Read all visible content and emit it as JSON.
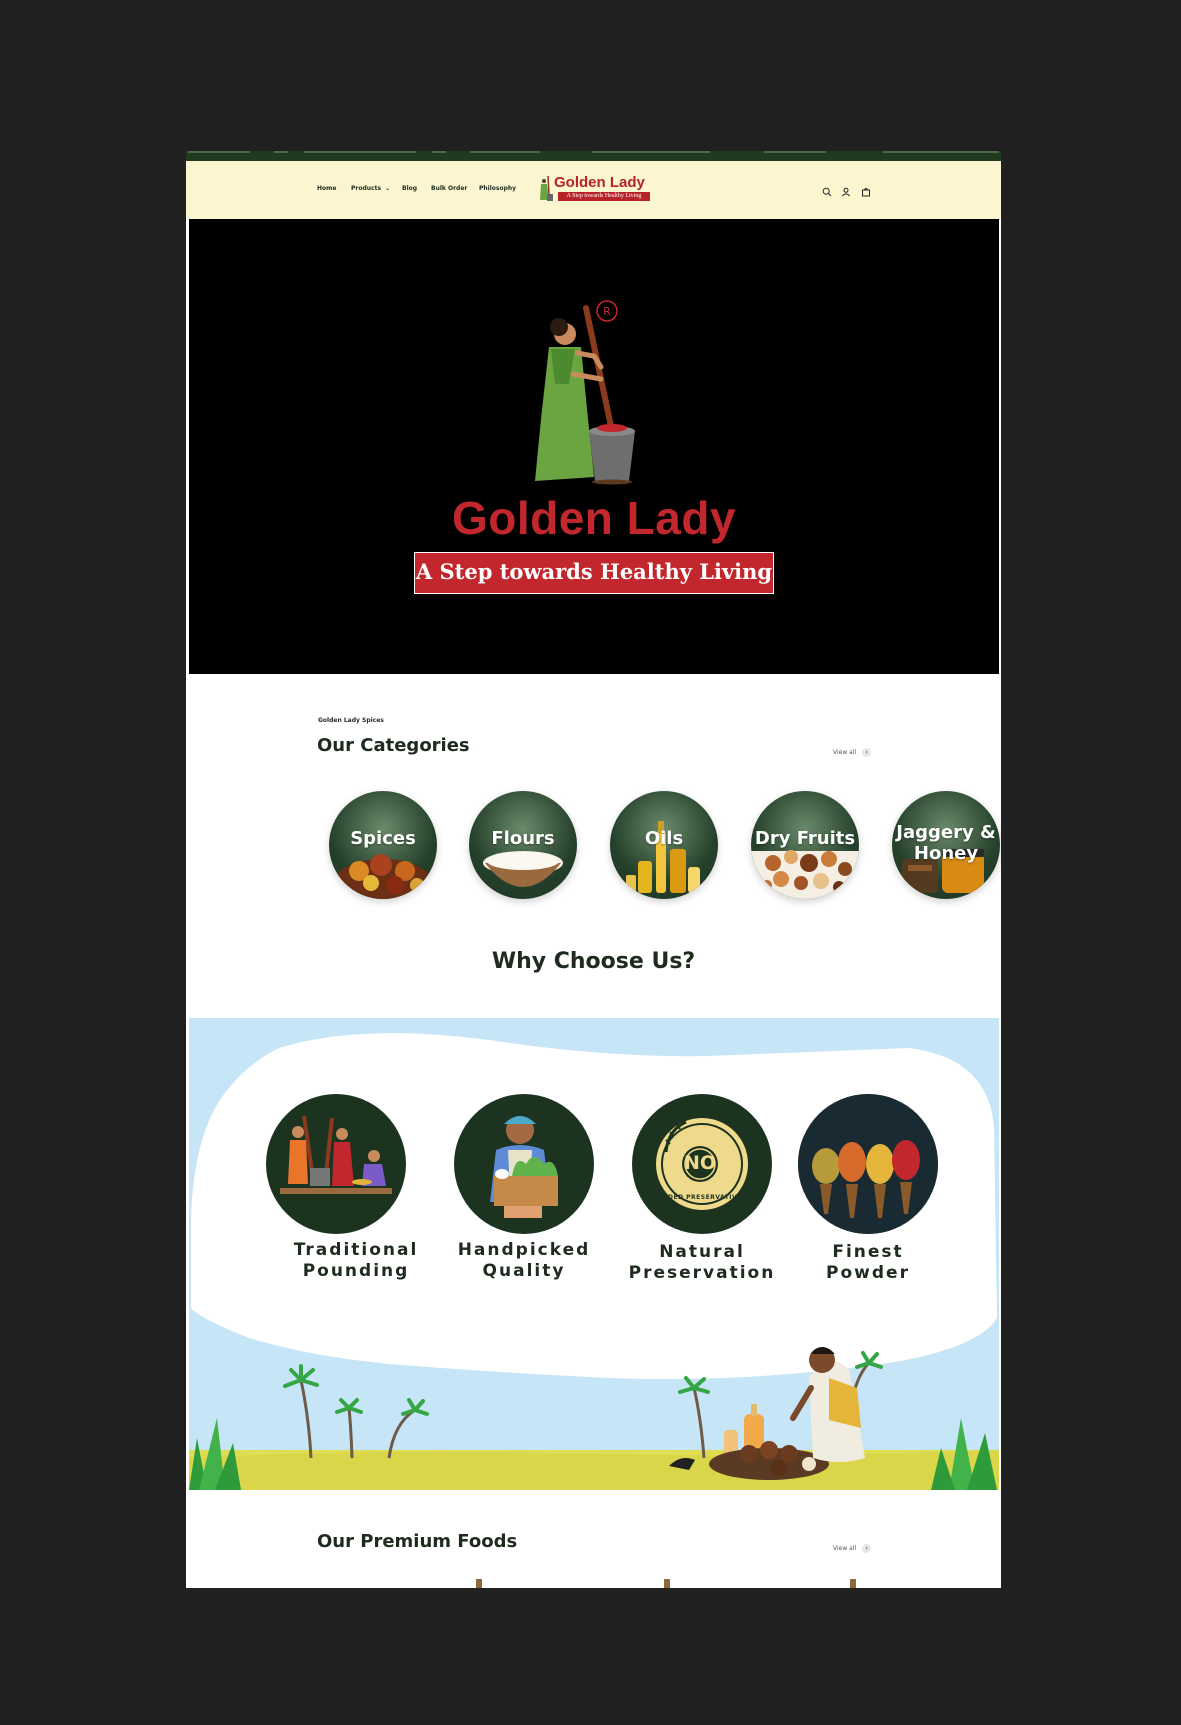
{
  "header": {
    "nav": [
      "Home",
      "Products",
      "Blog",
      "Bulk Order",
      "Philosophy"
    ],
    "logo_brand": "Golden Lady",
    "logo_tagline": "A Step towards Healthy Living",
    "icons": [
      "search-icon",
      "account-icon",
      "cart-icon"
    ]
  },
  "hero": {
    "registered_mark": "R",
    "brand": "Golden Lady",
    "tagline": "A Step towards Healthy Living"
  },
  "categories": {
    "eyebrow": "Golden Lady Spices",
    "title": "Our Categories",
    "view_all": "View all",
    "items": [
      {
        "label_line1": "Spices",
        "label_line2": ""
      },
      {
        "label_line1": "Flours",
        "label_line2": ""
      },
      {
        "label_line1": "Oils",
        "label_line2": ""
      },
      {
        "label_line1": "Dry Fruits",
        "label_line2": ""
      },
      {
        "label_line1": "Jaggery &",
        "label_line2": "Honey"
      }
    ]
  },
  "why": {
    "title": "Why Choose Us?",
    "badge_no": "NO",
    "badge_text": "ADDED PRESERVATIVES",
    "features": [
      {
        "line1": "Traditional",
        "line2": "Pounding"
      },
      {
        "line1": "Handpicked",
        "line2": "Quality"
      },
      {
        "line1": "Natural",
        "line2": "Preservation"
      },
      {
        "line1": "Finest",
        "line2": "Powder"
      }
    ]
  },
  "premium": {
    "title": "Our Premium Foods",
    "view_all": "View all"
  },
  "colors": {
    "brand_red": "#c1272d",
    "dark_green": "#1c3320",
    "header_cream": "#fbf6d0",
    "sky_blue": "#c6e6f7"
  }
}
